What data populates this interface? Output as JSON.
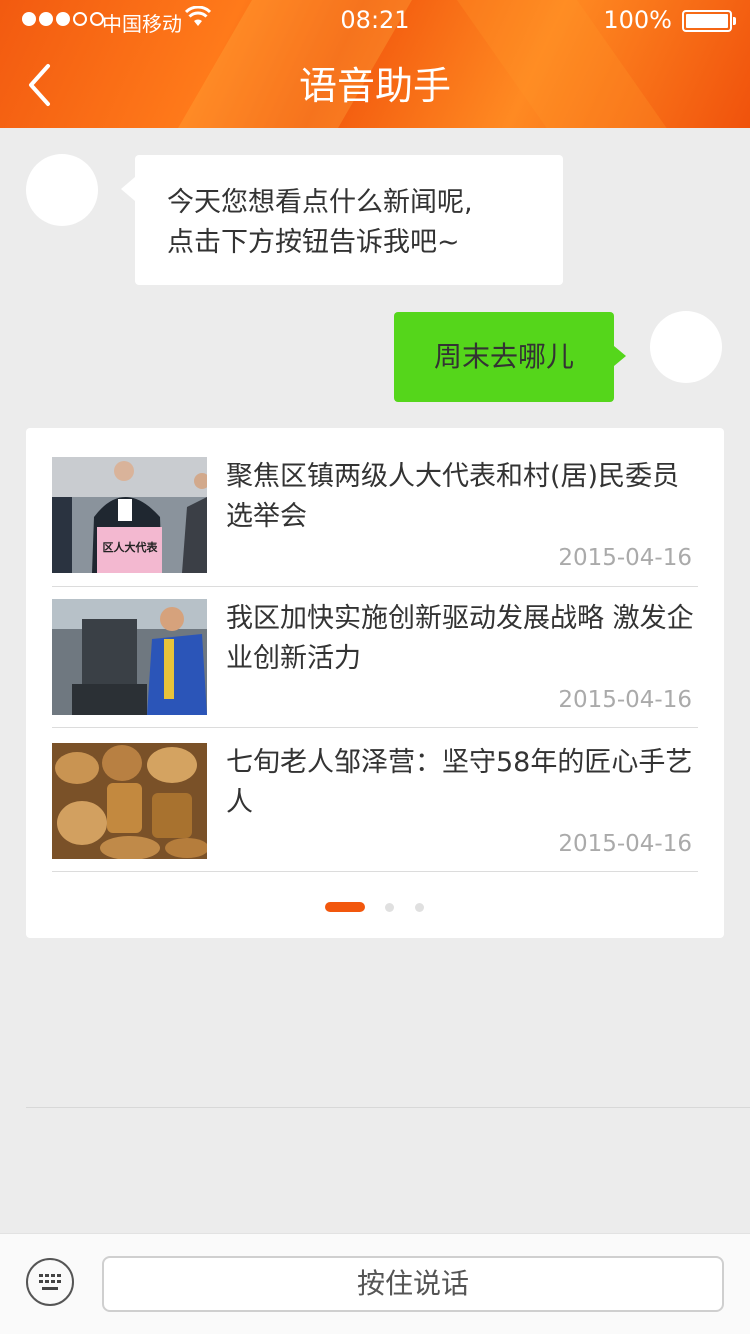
{
  "status_bar": {
    "carrier": "中国移动",
    "time": "08:21",
    "battery": "100%"
  },
  "header": {
    "title": "语音助手",
    "accent_color": "#f2570d"
  },
  "chat": {
    "assistant_message_line1": "今天您想看点什么新闻呢,",
    "assistant_message_line2": "点击下方按钮告诉我吧~",
    "user_message": "周末去哪儿",
    "user_bubble_color": "#55d61b"
  },
  "news": [
    {
      "title": "聚焦区镇两级人大代表和村(居)民委员选举会",
      "date": "2015-04-16",
      "image_caption": "区人大代表"
    },
    {
      "title": "我区加快实施创新驱动发展战略 激发企业创新活力",
      "date": "2015-04-16"
    },
    {
      "title": "七旬老人邹泽营：坚守58年的匠心手艺人",
      "date": "2015-04-16"
    }
  ],
  "pager": {
    "total_pages": 3,
    "current_page": 1
  },
  "bottom_bar": {
    "speak_label": "按住说话"
  }
}
